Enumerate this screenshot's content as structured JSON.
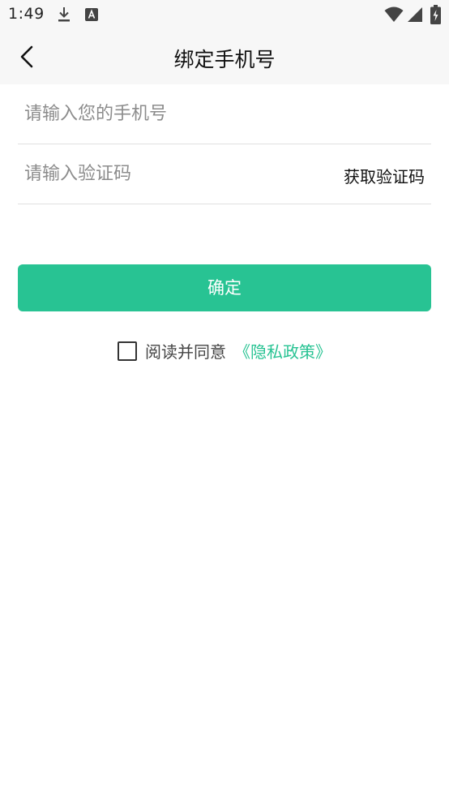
{
  "status_bar": {
    "time": "1:49",
    "icons": [
      "download-icon",
      "a-icon",
      "wifi-icon",
      "signal-icon",
      "battery-icon"
    ]
  },
  "title_bar": {
    "title": "绑定手机号",
    "back_icon": "chevron-left-icon"
  },
  "form": {
    "phone_placeholder": "请输入您的手机号",
    "phone_value": "",
    "code_placeholder": "请输入验证码",
    "code_value": "",
    "get_code_label": "获取验证码"
  },
  "confirm_label": "确定",
  "agreement": {
    "checked": false,
    "text": "阅读并同意",
    "link_label": "《隐私政策》"
  },
  "colors": {
    "accent": "#28c393",
    "bar_background": "#f7f7f7"
  }
}
